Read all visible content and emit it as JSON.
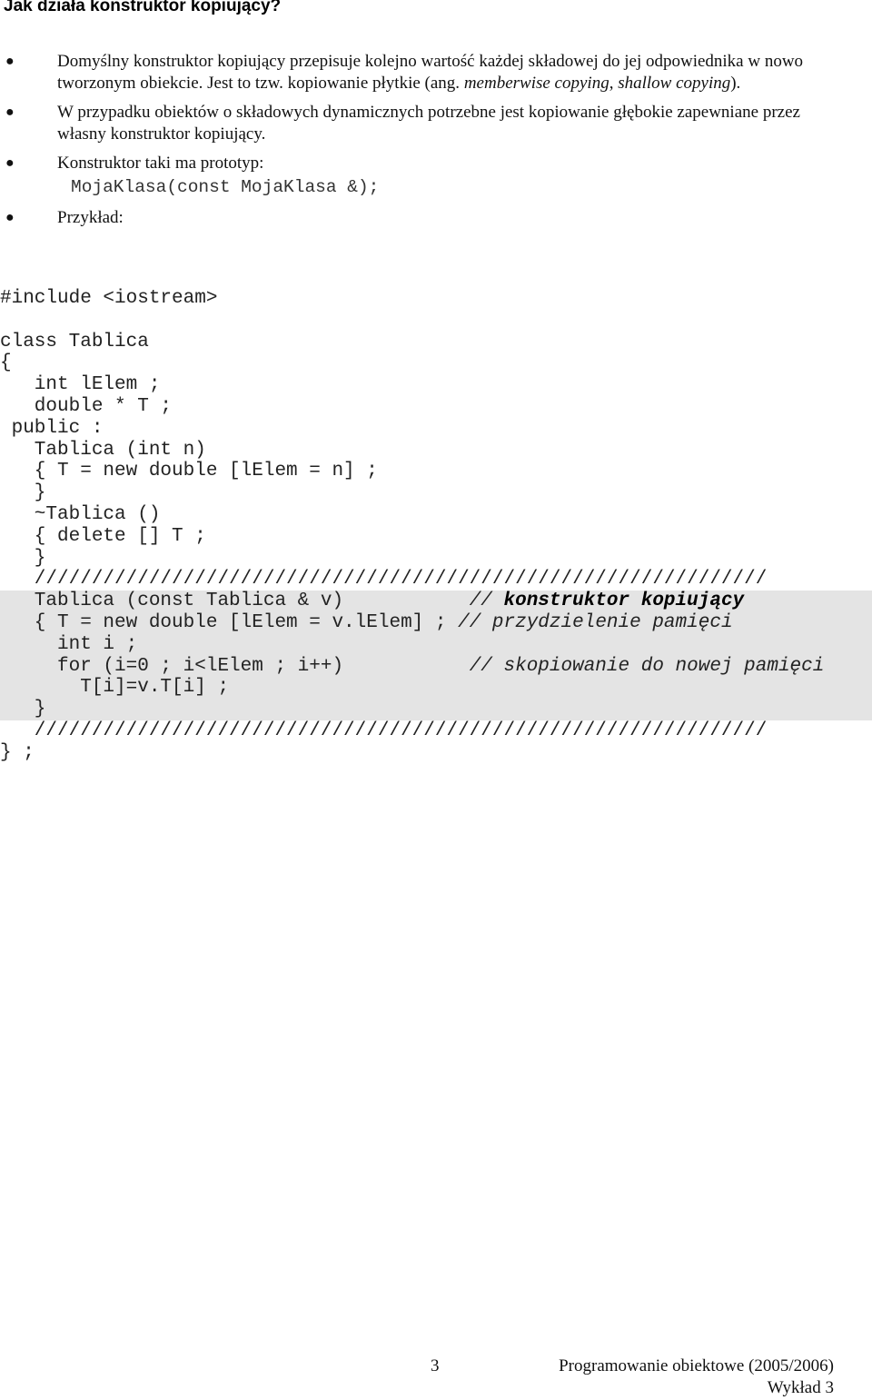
{
  "title": "Jak działa konstruktor kopiujący?",
  "bullets": [
    {
      "parts": [
        {
          "text": "Domyślny konstruktor kopiujący przepisuje kolejno wartość każdej składowej do jej odpowiednika w nowo tworzonym obiekcie. Jest to tzw. kopiowanie płytkie (ang. ",
          "italic": false
        },
        {
          "text": "memberwise copying",
          "italic": true
        },
        {
          "text": ", ",
          "italic": false
        },
        {
          "text": "shallow copying",
          "italic": true
        },
        {
          "text": ").",
          "italic": false
        }
      ]
    },
    {
      "parts": [
        {
          "text": "W przypadku obiektów o składowych dynamicznych potrzebne jest kopiowanie głębokie zapewniane przez własny konstruktor kopiujący.",
          "italic": false
        }
      ]
    },
    {
      "parts": [
        {
          "text": "Konstruktor taki ma prototyp:",
          "italic": false
        }
      ]
    },
    {
      "parts": [
        {
          "text": "Przykład:",
          "italic": false
        }
      ]
    }
  ],
  "prototype": "MojaKlasa(const MojaKlasa &);",
  "code": [
    {
      "text": "#include <iostream>",
      "hl": false
    },
    {
      "text": "",
      "hl": false
    },
    {
      "text": "class Tablica",
      "hl": false
    },
    {
      "text": "{",
      "hl": false
    },
    {
      "text": "   int lElem ;",
      "hl": false
    },
    {
      "text": "   double * T ;",
      "hl": false
    },
    {
      "text": " public :",
      "hl": false
    },
    {
      "text": "   Tablica (int n)",
      "hl": false
    },
    {
      "text": "   { T = new double [lElem = n] ;",
      "hl": false
    },
    {
      "text": "   }",
      "hl": false
    },
    {
      "text": "   ~Tablica ()",
      "hl": false
    },
    {
      "text": "   { delete [] T ;",
      "hl": false
    },
    {
      "text": "   }",
      "hl": false
    },
    {
      "text": "   ////////////////////////////////////////////////////////////////",
      "hl": false
    },
    {
      "text": "   Tablica (const Tablica & v)           ",
      "hl": true,
      "comment": "// ",
      "comment_bold": "konstruktor kopiujący"
    },
    {
      "text": "   { T = new double [lElem = v.lElem] ; ",
      "hl": true,
      "comment": "// przydzielenie pamięci"
    },
    {
      "text": "     int i ;",
      "hl": true
    },
    {
      "text": "     for (i=0 ; i<lElem ; i++)           ",
      "hl": true,
      "comment": "// skopiowanie do nowej pamięci"
    },
    {
      "text": "       T[i]=v.T[i] ;",
      "hl": true
    },
    {
      "text": "   }",
      "hl": true
    },
    {
      "text": "   ////////////////////////////////////////////////////////////////",
      "hl": false
    },
    {
      "text": "} ;",
      "hl": false
    }
  ],
  "footer": {
    "page_number": "3",
    "course": "Programowanie obiektowe (2005/2006)",
    "lecture": "Wykład 3"
  }
}
